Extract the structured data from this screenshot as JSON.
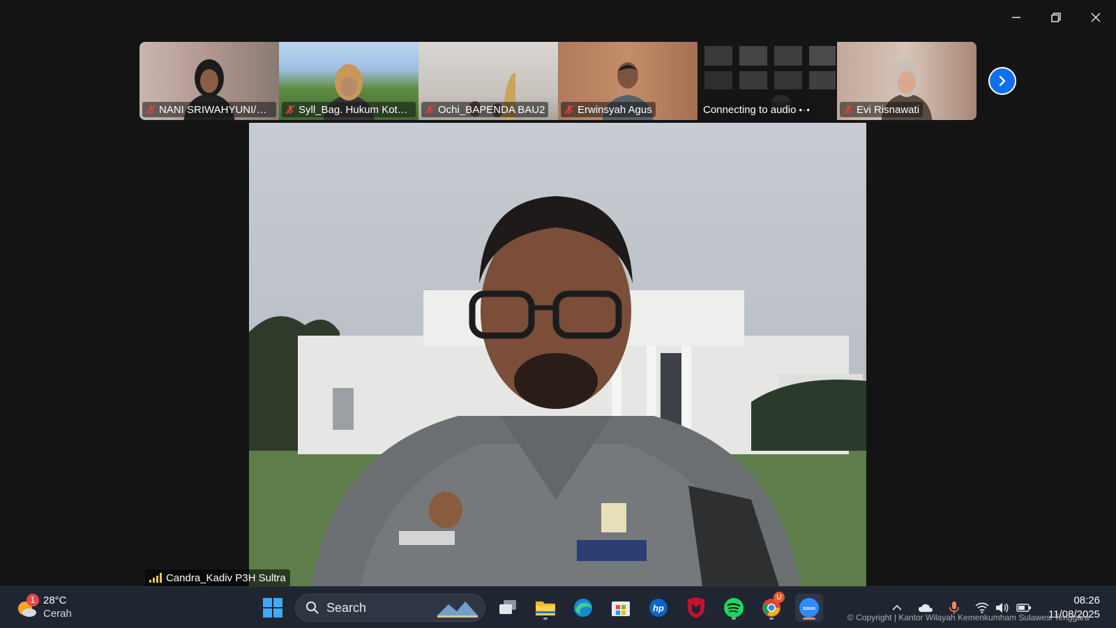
{
  "window": {
    "controls": {
      "minimize": "minimize",
      "restore": "restore",
      "close": "close"
    }
  },
  "participants": [
    {
      "name": "NANI SRIWAHYUNI/KA...",
      "muted": true
    },
    {
      "name": "Syll_Bag. Hukum Kota ...",
      "muted": true
    },
    {
      "name": "Ochi_BAPENDA BAU2",
      "muted": true
    },
    {
      "name": "Erwinsyah Agus",
      "muted": true
    },
    {
      "name": "Connecting to audio",
      "muted": false,
      "connecting": true
    },
    {
      "name": "Evi Risnawati",
      "muted": true
    }
  ],
  "strip": {
    "next_icon": "chevron-right-icon"
  },
  "active_speaker": {
    "name": "Candra_Kadiv P3H Sultra"
  },
  "taskbar": {
    "weather": {
      "badge": "1",
      "temp": "28°C",
      "condition": "Cerah"
    },
    "search": {
      "placeholder": "Search"
    },
    "apps": [
      "windows-start",
      "task-view",
      "file-explorer",
      "edge",
      "microsoft-store",
      "hp",
      "mcafee",
      "spotify",
      "chrome",
      "zoom"
    ],
    "chrome_badge": "U",
    "clock": {
      "time": "08:26",
      "date": "11/08/2025"
    }
  },
  "watermark": "© Copyright | Kantor Wilayah Kemenkumham Sulawesi Tenggara",
  "colors": {
    "zoom_blue": "#0e71eb",
    "muted_red": "#e0413b",
    "taskbar": "#1f2632"
  }
}
